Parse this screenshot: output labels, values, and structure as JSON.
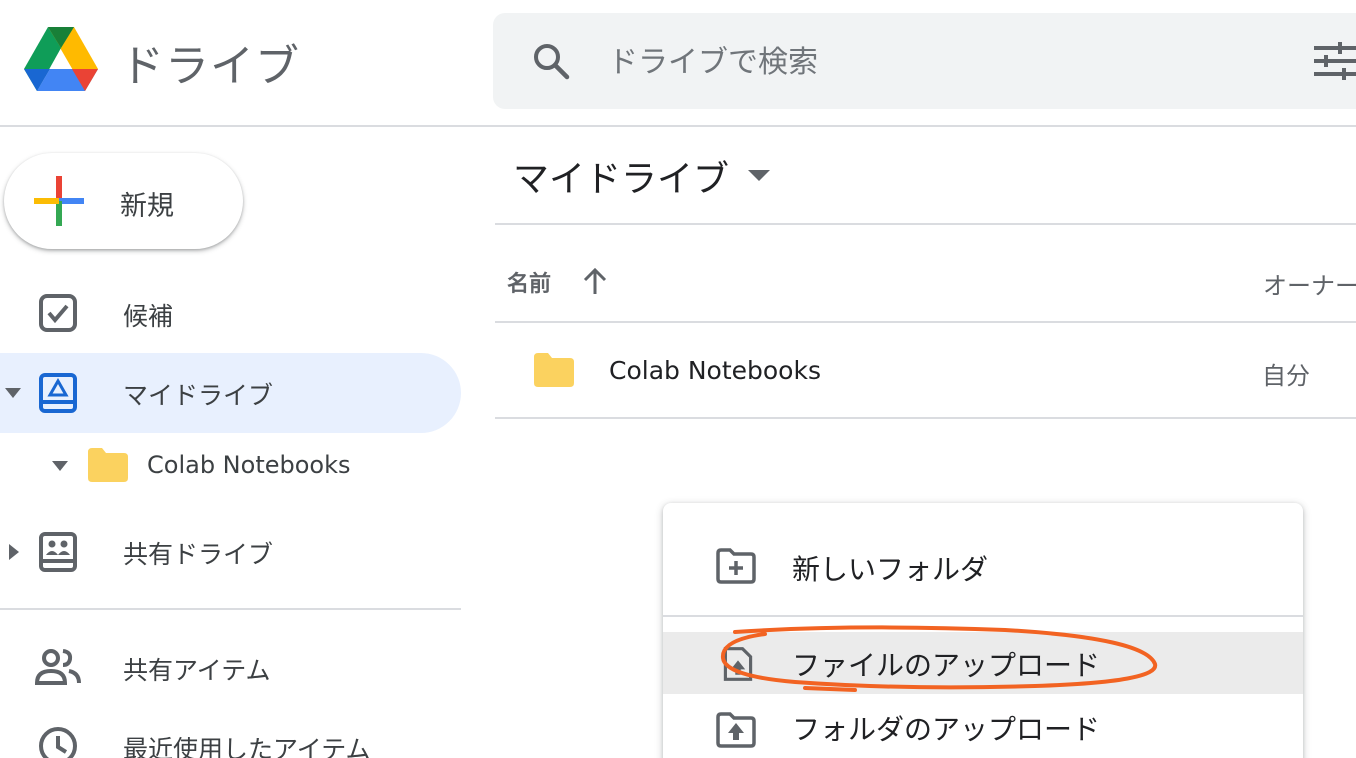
{
  "app": {
    "title": "ドライブ"
  },
  "search": {
    "placeholder": "ドライブで検索"
  },
  "sidebar": {
    "new_label": "新規",
    "items": [
      {
        "label": "候補",
        "icon": "suggested-check-icon"
      },
      {
        "label": "マイドライブ",
        "icon": "my-drive-icon",
        "active": true
      },
      {
        "label": "Colab Notebooks",
        "icon": "folder-icon"
      },
      {
        "label": "共有ドライブ",
        "icon": "shared-drive-icon"
      },
      {
        "label": "共有アイテム",
        "icon": "people-icon"
      },
      {
        "label": "最近使用したアイテム",
        "icon": "clock-icon"
      }
    ]
  },
  "main": {
    "breadcrumb": "マイドライブ",
    "columns": {
      "name": "名前",
      "owner": "オーナー"
    },
    "rows": [
      {
        "name": "Colab Notebooks",
        "owner": "自分",
        "icon": "folder-icon"
      }
    ]
  },
  "menu": {
    "items": [
      {
        "label": "新しいフォルダ",
        "icon": "new-folder-icon"
      },
      {
        "label": "ファイルのアップロード",
        "icon": "file-upload-icon",
        "highlighted": true
      },
      {
        "label": "フォルダのアップロード",
        "icon": "folder-upload-icon"
      }
    ]
  },
  "colors": {
    "accent_blue": "#1967d2",
    "active_bg": "#e8f0fe",
    "folder_yellow": "#fbd25f",
    "annotation_orange": "#f26322"
  }
}
